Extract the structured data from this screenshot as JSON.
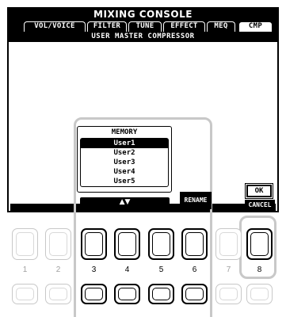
{
  "screen": {
    "title": "MIXING CONSOLE",
    "tabs": [
      {
        "label": "VOL/VOICE",
        "active": false
      },
      {
        "label": "FILTER",
        "active": false
      },
      {
        "label": "TUNE",
        "active": false
      },
      {
        "label": "EFFECT",
        "active": false
      },
      {
        "label": "MEQ",
        "active": false
      },
      {
        "label": "CMP",
        "active": true
      }
    ],
    "subheading": "USER MASTER COMPRESSOR"
  },
  "memory": {
    "title": "MEMORY",
    "items": [
      {
        "label": "User1",
        "selected": true
      },
      {
        "label": "User2",
        "selected": false
      },
      {
        "label": "User3",
        "selected": false
      },
      {
        "label": "User4",
        "selected": false
      },
      {
        "label": "User5",
        "selected": false
      }
    ],
    "scroll_label": "▲▼"
  },
  "buttons": {
    "rename_label": "RENAME",
    "ok_label": "OK",
    "cancel_label": "CANCEL"
  },
  "panel_buttons": {
    "numbers": [
      "1",
      "2",
      "3",
      "4",
      "5",
      "6",
      "7",
      "8"
    ]
  }
}
